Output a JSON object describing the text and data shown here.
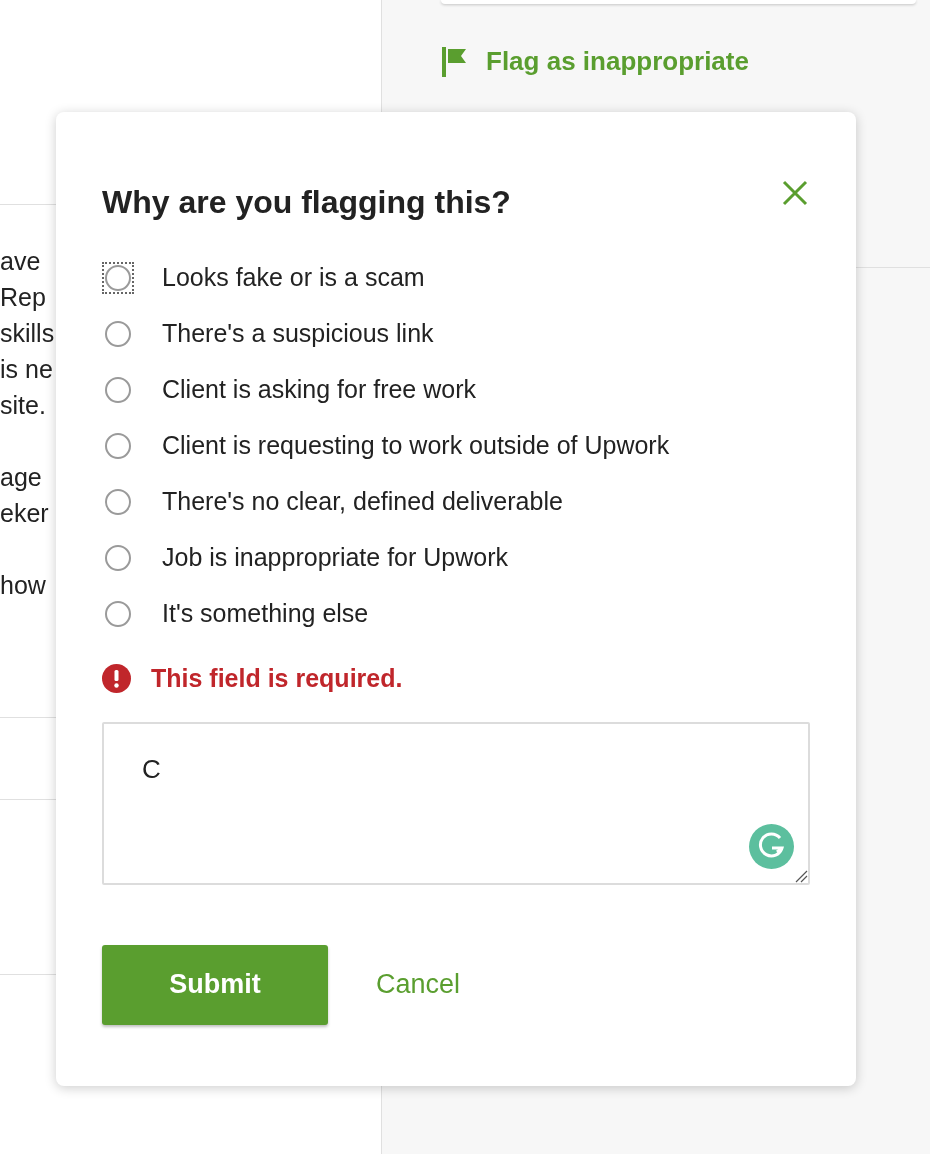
{
  "background": {
    "paragraphs": [
      {
        "lines": [
          "ave",
          "Rep",
          "skills",
          "is ne",
          "site."
        ]
      },
      {
        "lines": [
          "age",
          "eker"
        ]
      },
      {
        "lines": [
          "how"
        ]
      }
    ],
    "flag_link": "Flag as inappropriate"
  },
  "dialog": {
    "title": "Why are you flagging this?",
    "options": [
      {
        "label": "Looks fake or is a scam",
        "selected": false,
        "focused": true
      },
      {
        "label": "There's a suspicious link",
        "selected": false,
        "focused": false
      },
      {
        "label": "Client is asking for free work",
        "selected": false,
        "focused": false
      },
      {
        "label": "Client is requesting to work outside of Upwork",
        "selected": false,
        "focused": false
      },
      {
        "label": "There's no clear, defined deliverable",
        "selected": false,
        "focused": false
      },
      {
        "label": "Job is inappropriate for Upwork",
        "selected": false,
        "focused": false
      },
      {
        "label": "It's something else",
        "selected": false,
        "focused": false
      }
    ],
    "error": "This field is required.",
    "comment": {
      "value": "C"
    },
    "buttons": {
      "submit": "Submit",
      "cancel": "Cancel"
    }
  }
}
